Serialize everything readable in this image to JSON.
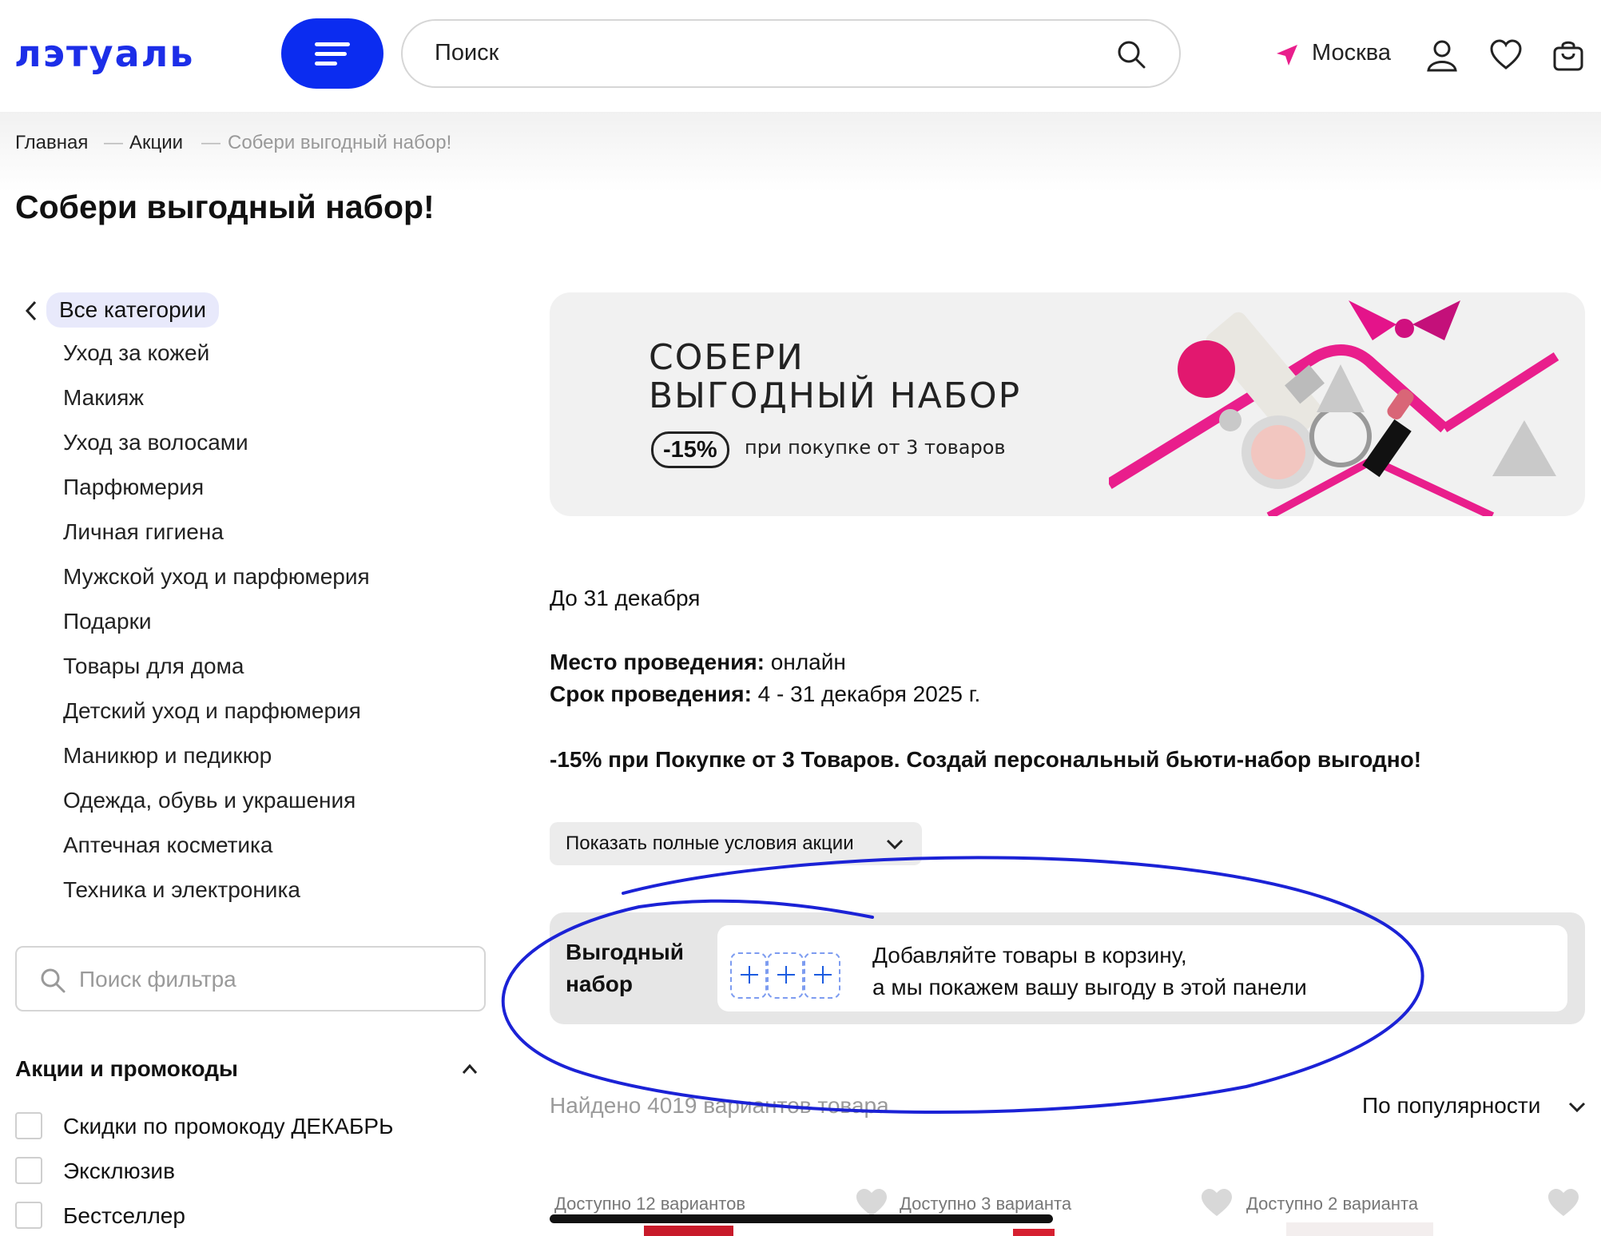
{
  "header": {
    "logo": "лэтуаль",
    "search_placeholder": "Поиск",
    "city": "Москва"
  },
  "breadcrumb": [
    "Главная",
    "Акции",
    "Собери выгодный набор!"
  ],
  "page_title": "Собери выгодный набор!",
  "sidebar": {
    "back_label": "Все категории",
    "categories": [
      "Уход за кожей",
      "Макияж",
      "Уход за волосами",
      "Парфюмерия",
      "Личная гигиена",
      "Мужской уход и парфюмерия",
      "Подарки",
      "Товары для дома",
      "Детский уход и парфюмерия",
      "Маникюр и педикюр",
      "Одежда, обувь и украшения",
      "Аптечная косметика",
      "Техника и электроника"
    ],
    "filter_placeholder": "Поиск фильтра",
    "promo_section_title": "Акции и промокоды",
    "promo_options": [
      "Скидки по промокоду ДЕКАБРЬ",
      "Эксклюзив",
      "Бестселлер"
    ]
  },
  "banner": {
    "line1": "СОБЕРИ",
    "line2": "ВЫГОДНЫЙ НАБОР",
    "discount": "-15%",
    "subtitle": "при покупке от 3 товаров"
  },
  "promo_info": {
    "until": "До 31 декабря",
    "place_label": "Место проведения:",
    "place_value": "онлайн",
    "period_label": "Срок проведения:",
    "period_value": "4 - 31 декабря 2025 г.",
    "headline": "-15% при Покупке от 3 Товаров. Создай персональный бьюти-набор выгодно!",
    "show_conditions": "Показать полные условия акции"
  },
  "benefit_panel": {
    "title_line1": "Выгодный",
    "title_line2": "набор",
    "text_line1": "Добавляйте товары в корзину,",
    "text_line2": "а мы покажем вашу выгоду в этой панели"
  },
  "results": {
    "found": "Найдено 4019 вариантов товара",
    "sort": "По популярности"
  },
  "products": [
    {
      "availability": "Доступно 12 вариантов"
    },
    {
      "availability": "Доступно 3 варианта"
    },
    {
      "availability": "Доступно 2 варианта"
    }
  ],
  "colors": {
    "brand": "#0b2cf0",
    "accent_pink": "#e91e8c",
    "annotation": "#1b22d6"
  }
}
